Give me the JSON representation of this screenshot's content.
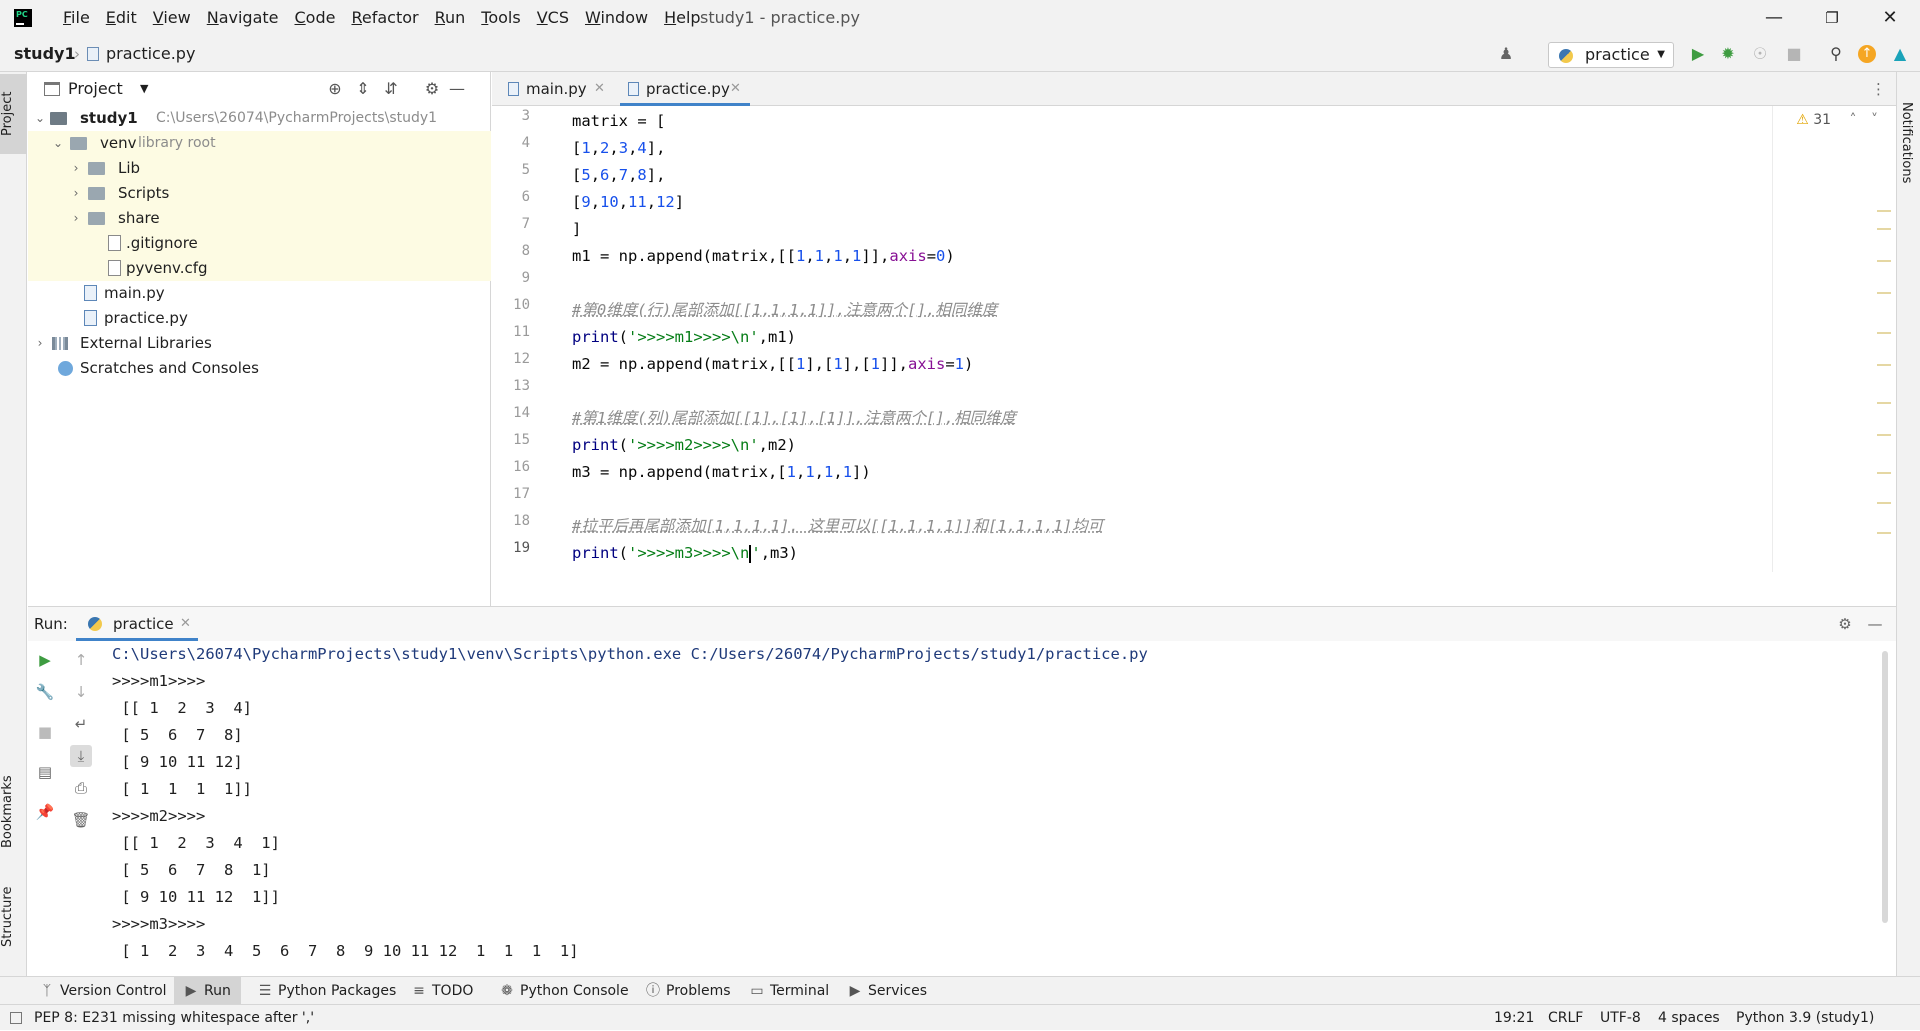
{
  "app": {
    "menus": [
      "File",
      "Edit",
      "View",
      "Navigate",
      "Code",
      "Refactor",
      "Run",
      "Tools",
      "VCS",
      "Window",
      "Help"
    ],
    "window_title": "study1 - practice.py"
  },
  "navbar": {
    "project": "study1",
    "file": "practice.py",
    "run_config": "practice"
  },
  "project_panel": {
    "title": "Project",
    "tree": {
      "root_name": "study1",
      "root_path": "C:\\Users\\26074\\PycharmProjects\\study1",
      "venv": "venv",
      "venv_hint": "library root",
      "lib": "Lib",
      "scripts": "Scripts",
      "share": "share",
      "gitignore": ".gitignore",
      "pyvenv": "pyvenv.cfg",
      "main": "main.py",
      "practice": "practice.py",
      "external": "External Libraries",
      "scratches": "Scratches and Consoles"
    }
  },
  "editor": {
    "tabs": [
      "main.py",
      "practice.py"
    ],
    "warning_count": "31",
    "line_numbers": [
      "3",
      "4",
      "5",
      "6",
      "7",
      "8",
      "9",
      "10",
      "11",
      "12",
      "13",
      "14",
      "15",
      "16",
      "17",
      "18",
      "19"
    ]
  },
  "run": {
    "label": "Run:",
    "tab": "practice",
    "console": [
      "C:\\Users\\26074\\PycharmProjects\\study1\\venv\\Scripts\\python.exe C:/Users/26074/PycharmProjects/study1/practice.py",
      ">>>>m1>>>>",
      " [[ 1  2  3  4]",
      " [ 5  6  7  8]",
      " [ 9 10 11 12]",
      " [ 1  1  1  1]]",
      ">>>>m2>>>>",
      " [[ 1  2  3  4  1]",
      " [ 5  6  7  8  1]",
      " [ 9 10 11 12  1]]",
      ">>>>m3>>>>",
      " [ 1  2  3  4  5  6  7  8  9 10 11 12  1  1  1  1]"
    ]
  },
  "side_tabs": {
    "project": "Project",
    "bookmarks": "Bookmarks",
    "structure": "Structure",
    "notifications": "Notifications"
  },
  "tool_windows": [
    "Version Control",
    "Run",
    "Python Packages",
    "TODO",
    "Python Console",
    "Problems",
    "Terminal",
    "Services"
  ],
  "status": {
    "message": "PEP 8: E231 missing whitespace after ','",
    "position": "19:21",
    "line_sep": "CRLF",
    "encoding": "UTF-8",
    "indent": "4 spaces",
    "interpreter": "Python 3.9 (study1)"
  }
}
